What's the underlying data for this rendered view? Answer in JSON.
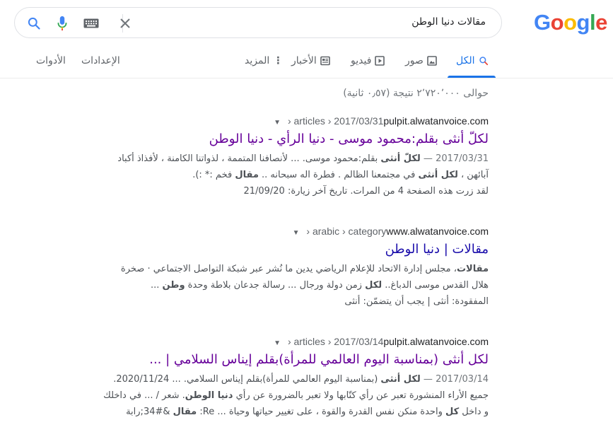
{
  "logo": {
    "letters": [
      "G",
      "o",
      "o",
      "g",
      "l",
      "e"
    ],
    "colors": [
      "#4285F4",
      "#EA4335",
      "#FBBC05",
      "#4285F4",
      "#34A853",
      "#EA4335"
    ]
  },
  "search": {
    "query": "مقالات دنيا الوطن"
  },
  "icons": {
    "search": "search-icon",
    "mic": "mic-icon",
    "keyboard": "keyboard-icon",
    "clear": "close-icon"
  },
  "tabs": {
    "all": "الكل",
    "images": "صور",
    "videos": "فيديو",
    "news": "الأخبار",
    "more": "المزيد",
    "settings": "الإعدادات",
    "tools": "الأدوات"
  },
  "stats": "حوالى ٢٬٧٢٠٬٠٠٠ نتيجة (٠٫٥٧ ثانية)",
  "results": [
    {
      "cite_domain": "pulpit.alwatanvoice.com",
      "cite_path": " › articles › 2017/03/31",
      "title": "لكلّ أنثى بقلم:محمود موسى - دنيا الرأي - دنيا الوطن",
      "snippet_line1_date": "2017/03/31 — ",
      "snippet_line1_bold": "لكلّ أنثى",
      "snippet_line1_rest": " بقلم:محمود موسى. ... لأنصافنا المتممة ، لذواتنا الكامنة ، لأفذاذ أكباد",
      "snippet_line2_a": "آبائهن ، ",
      "snippet_line2_bold1": "لكل أنثى",
      "snippet_line2_b": " في مجتمعنا الظالم . فطرة اله سبحانه .. ",
      "snippet_line2_bold2": "مقال",
      "snippet_line2_c": " فخم :* :).",
      "visit": "لقد زرت هذه الصفحة 4 من المرات. تاريخ آخر زيارة: 21/09/20"
    },
    {
      "cite_domain": "www.alwatanvoice.com",
      "cite_path": " › arabic › category",
      "title": "مقالات | دنيا الوطن",
      "snippet_line1_bold": "مقالات",
      "snippet_line1_rest": "، مجلس إدارة الاتحاد للإعلام الرياضي يدين ما نُشر عبر شبكة التواصل الاجتماعي · صخرة",
      "snippet_line2_a": "هلال القدس موسى الدباغ.. ",
      "snippet_line2_bold1": "لكل",
      "snippet_line2_b": " زمن دولة ورجال ... رسالة جدعان بلاطة وحدة ",
      "snippet_line2_bold2": "وطن",
      "snippet_line2_c": " ...",
      "missing": "المفقودة: أنثى | يجب أن يتضمّن: أنثى"
    },
    {
      "cite_domain": "pulpit.alwatanvoice.com",
      "cite_path": " › articles › 2017/03/14",
      "title": "لكل أنثى (بمناسبة اليوم العالمي للمرأة)بقلم إيناس السلامي | ...",
      "snippet_line1_date": "2017/03/14 — ",
      "snippet_line1_bold": "لكل أنثى",
      "snippet_line1_rest": " (بمناسبة اليوم العالمي للمرأة)بقلم إيناس السلامي. ... 2020/11/24.",
      "snippet_line2_a": "جميع الأراء المنشورة تعبر عن رأي كتّابها ولا تعبر بالضرورة عن رأي ",
      "snippet_line2_bold1": "دنيا الوطن",
      "snippet_line2_b": ". شعر / ... في داخلك",
      "snippet_line3_a": "و داخل ",
      "snippet_line3_bold1": "كل",
      "snippet_line3_b": " واحدة منكن نفس القدرة والقوة ، على تغيير حياتها وحياة ... Re: ",
      "snippet_line3_bold2": "مقال",
      "snippet_line3_c": " &#34;رابة"
    }
  ]
}
